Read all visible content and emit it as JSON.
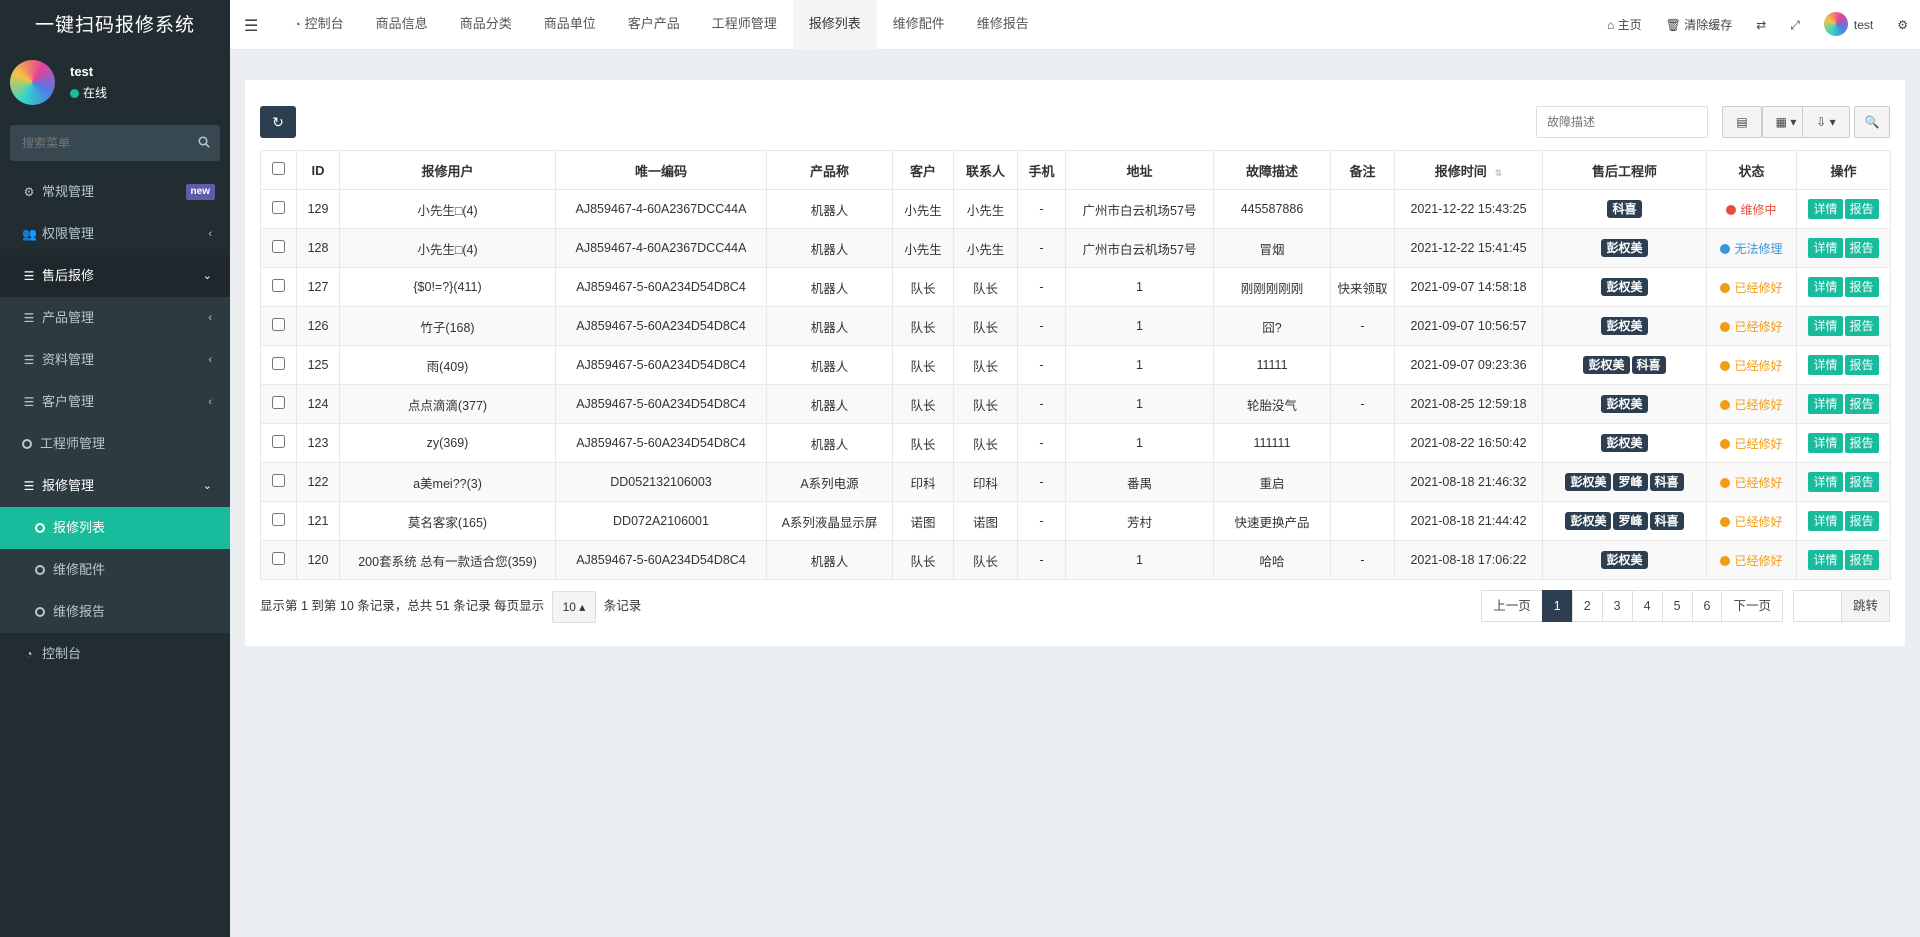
{
  "app": {
    "title": "一键扫码报修系统"
  },
  "user": {
    "name": "test",
    "status": "在线"
  },
  "sidebar": {
    "search_placeholder": "搜索菜单",
    "items": [
      {
        "label": "常规管理",
        "badge": "new"
      },
      {
        "label": "权限管理"
      },
      {
        "label": "售后报修"
      },
      {
        "label": "产品管理"
      },
      {
        "label": "资料管理"
      },
      {
        "label": "客户管理"
      },
      {
        "label": "工程师管理"
      },
      {
        "label": "报修管理"
      },
      {
        "label": "报修列表"
      },
      {
        "label": "维修配件"
      },
      {
        "label": "维修报告"
      },
      {
        "label": "控制台"
      }
    ]
  },
  "topbar": {
    "tabs": [
      "控制台",
      "商品信息",
      "商品分类",
      "商品单位",
      "客户产品",
      "工程师管理",
      "报修列表",
      "维修配件",
      "维修报告"
    ],
    "home": "主页",
    "clear_cache": "清除缓存",
    "user": "test"
  },
  "toolbar": {
    "search_placeholder": "故障描述"
  },
  "table": {
    "headers": [
      "ID",
      "报修用户",
      "唯一编码",
      "产品称",
      "客户",
      "联系人",
      "手机",
      "地址",
      "故障描述",
      "备注",
      "报修时间",
      "售后工程师",
      "状态",
      "操作"
    ],
    "detail_label": "详情",
    "report_label": "报告",
    "rows": [
      {
        "id": "129",
        "user": "小先生□(4)",
        "code": "AJ859467-4-60A2367DCC44A",
        "product": "机器人",
        "customer": "小先生",
        "contact": "小先生",
        "phone": "-",
        "address": "广州市白云机场57号",
        "fault": "445587886",
        "remark": "",
        "time": "2021-12-22 15:43:25",
        "engineers": [
          "科喜"
        ],
        "status": "维修中",
        "status_color": "#e74c3c"
      },
      {
        "id": "128",
        "user": "小先生□(4)",
        "code": "AJ859467-4-60A2367DCC44A",
        "product": "机器人",
        "customer": "小先生",
        "contact": "小先生",
        "phone": "-",
        "address": "广州市白云机场57号",
        "fault": "冒烟",
        "remark": "",
        "time": "2021-12-22 15:41:45",
        "engineers": [
          "彭权美"
        ],
        "status": "无法修理",
        "status_color": "#3498db"
      },
      {
        "id": "127",
        "user": "{$0!=?}(411)",
        "code": "AJ859467-5-60A234D54D8C4",
        "product": "机器人",
        "customer": "队长",
        "contact": "队长",
        "phone": "-",
        "address": "1",
        "fault": "刚刚刚刚刚",
        "remark": "快来领取",
        "time": "2021-09-07 14:58:18",
        "engineers": [
          "彭权美"
        ],
        "status": "已经修好",
        "status_color": "#f39c12"
      },
      {
        "id": "126",
        "user": "竹子(168)",
        "code": "AJ859467-5-60A234D54D8C4",
        "product": "机器人",
        "customer": "队长",
        "contact": "队长",
        "phone": "-",
        "address": "1",
        "fault": "囧?",
        "remark": "-",
        "time": "2021-09-07 10:56:57",
        "engineers": [
          "彭权美"
        ],
        "status": "已经修好",
        "status_color": "#f39c12"
      },
      {
        "id": "125",
        "user": "雨(409)",
        "code": "AJ859467-5-60A234D54D8C4",
        "product": "机器人",
        "customer": "队长",
        "contact": "队长",
        "phone": "-",
        "address": "1",
        "fault": "11111",
        "remark": "",
        "time": "2021-09-07 09:23:36",
        "engineers": [
          "彭权美",
          "科喜"
        ],
        "status": "已经修好",
        "status_color": "#f39c12"
      },
      {
        "id": "124",
        "user": "点点滴滴(377)",
        "code": "AJ859467-5-60A234D54D8C4",
        "product": "机器人",
        "customer": "队长",
        "contact": "队长",
        "phone": "-",
        "address": "1",
        "fault": "轮胎没气",
        "remark": "-",
        "time": "2021-08-25 12:59:18",
        "engineers": [
          "彭权美"
        ],
        "status": "已经修好",
        "status_color": "#f39c12"
      },
      {
        "id": "123",
        "user": "zy(369)",
        "code": "AJ859467-5-60A234D54D8C4",
        "product": "机器人",
        "customer": "队长",
        "contact": "队长",
        "phone": "-",
        "address": "1",
        "fault": "111111",
        "remark": "",
        "time": "2021-08-22 16:50:42",
        "engineers": [
          "彭权美"
        ],
        "status": "已经修好",
        "status_color": "#f39c12"
      },
      {
        "id": "122",
        "user": "a美mei??(3)",
        "code": "DD052132106003",
        "product": "A系列电源",
        "customer": "印科",
        "contact": "印科",
        "phone": "-",
        "address": "番禺",
        "fault": "重启",
        "remark": "",
        "time": "2021-08-18 21:46:32",
        "engineers": [
          "彭权美",
          "罗峰",
          "科喜"
        ],
        "status": "已经修好",
        "status_color": "#f39c12"
      },
      {
        "id": "121",
        "user": "莫名客家(165)",
        "code": "DD072A2106001",
        "product": "A系列液晶显示屏",
        "customer": "诺图",
        "contact": "诺图",
        "phone": "-",
        "address": "芳村",
        "fault": "快速更换产品",
        "remark": "",
        "time": "2021-08-18 21:44:42",
        "engineers": [
          "彭权美",
          "罗峰",
          "科喜"
        ],
        "status": "已经修好",
        "status_color": "#f39c12"
      },
      {
        "id": "120",
        "user": "200套系统 总有一款适合您(359)",
        "code": "AJ859467-5-60A234D54D8C4",
        "product": "机器人",
        "customer": "队长",
        "contact": "队长",
        "phone": "-",
        "address": "1",
        "fault": "哈哈",
        "remark": "-",
        "time": "2021-08-18 17:06:22",
        "engineers": [
          "彭权美"
        ],
        "status": "已经修好",
        "status_color": "#f39c12"
      }
    ]
  },
  "footer": {
    "summary_prefix": "显示第 1 到第 10 条记录，总共 51 条记录 每页显示",
    "page_size": "10",
    "summary_suffix": "条记录",
    "prev": "上一页",
    "pages": [
      "1",
      "2",
      "3",
      "4",
      "5",
      "6"
    ],
    "next": "下一页",
    "jump": "跳转"
  },
  "colors": {
    "accent": "#18bc9c",
    "dark": "#2c3e50",
    "sidebar": "#222d32"
  }
}
